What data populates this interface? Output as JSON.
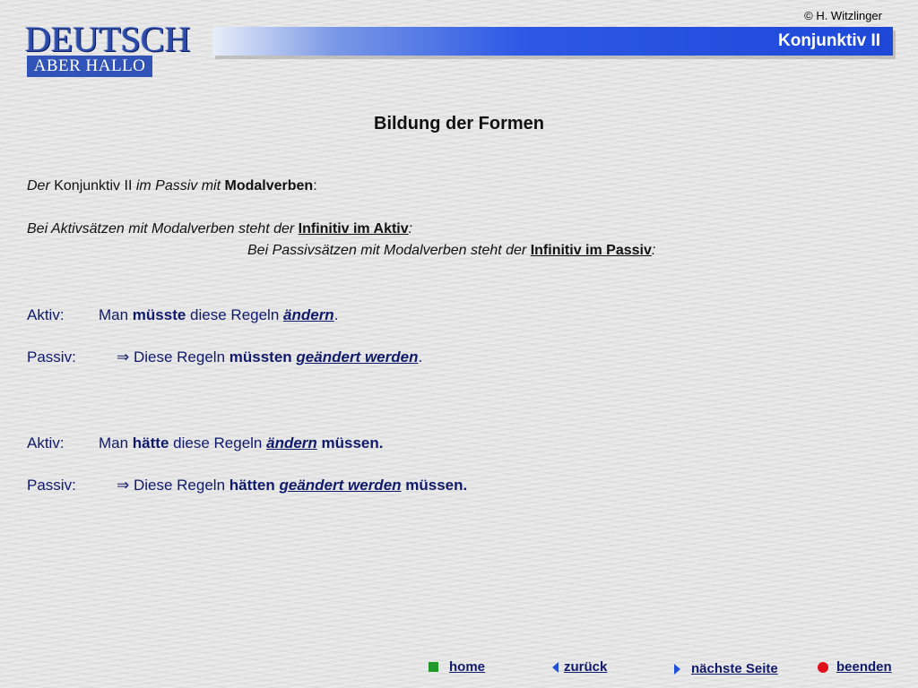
{
  "header": {
    "copyright": "© H. Witzlinger",
    "logo_main": "DEUTSCH",
    "logo_sub": "ABER HALLO",
    "title": "Konjunktiv II"
  },
  "content": {
    "heading": "Bildung der Formen",
    "intro": {
      "p1": "Der",
      "p2": " Konjunktiv II ",
      "p3": "im Passiv mit",
      "p4": "Modalverben",
      "p5": ":"
    },
    "aktiv_rule": {
      "p1": "Bei Aktivsätzen mit Modalverben steht der ",
      "p2": "Infinitiv im Aktiv",
      "p3": ":"
    },
    "passiv_rule": {
      "p1": "Bei Passivsätzen mit Modalverben steht der ",
      "p2": "Infinitiv im Passiv",
      "p3": ":"
    },
    "examples": [
      {
        "aktiv_label": "Aktiv:",
        "aktiv": {
          "a": "Man ",
          "b": "müsste",
          "c": " diese Regeln ",
          "d": "ändern",
          "e": "."
        },
        "passiv_label": "Passiv:",
        "passiv": {
          "arrow": "⇒",
          "a": " Diese Regeln ",
          "b": "müssten",
          "c": " ",
          "d": "geändert werden",
          "e": "."
        }
      },
      {
        "aktiv_label": "Aktiv:",
        "aktiv": {
          "a": "Man ",
          "b": "hätte",
          "c": " diese Regeln ",
          "d": "ändern",
          "e": " müssen."
        },
        "passiv_label": "Passiv:",
        "passiv": {
          "arrow": "⇒",
          "a": " Diese Regeln ",
          "b": "hätten",
          "c": " ",
          "d": "geändert werden",
          "e": " müssen."
        }
      }
    ]
  },
  "nav": {
    "home": "home",
    "back": "zurück",
    "next": "nächste Seite",
    "quit": "beenden",
    "icons": {
      "home": "green-square-icon",
      "back": "left-triangle-icon",
      "next": "right-triangle-icon",
      "quit": "red-dot-icon"
    },
    "colors": {
      "home_icon": "#1f9a2a",
      "quit_icon": "#e0101a",
      "arrow_icon": "#2050d8",
      "title_bar": "#1e48d8"
    }
  }
}
